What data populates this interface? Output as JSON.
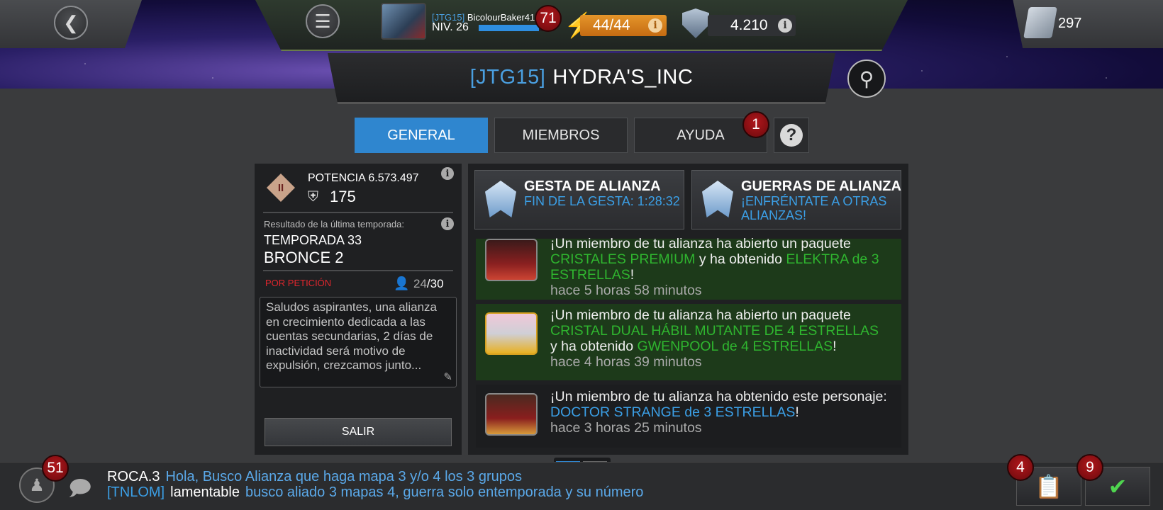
{
  "top_bar": {
    "player_tag": "[JTG15]",
    "player_name": "BicolourBaker41",
    "player_level": "NIV. 26",
    "xp_progress": 0.85,
    "level_badge": "71",
    "energy": "44/44",
    "units": "4.210",
    "crystals": "297"
  },
  "alliance": {
    "tag": "[JTG15]",
    "name": "HYDRA'S_INC"
  },
  "tabs": {
    "general": "GENERAL",
    "members": "MIEMBROS",
    "help": "AYUDA",
    "help_badge": "1"
  },
  "overview": {
    "potency_label": "POTENCIA 6.573.497",
    "rank": "175",
    "season_caption": "Resultado de la última temporada:",
    "season_name": "TEMPORADA 33",
    "season_tier": "BRONCE 2",
    "request_label": "POR PETICIÓN",
    "member_current": "24",
    "member_max": "/30",
    "description": "Saludos aspirantes, una alianza en crecimiento dedicada a las cuentas secundarias, 2 días de inactividad será motivo de expulsión, crezcamos junto...",
    "leave_label": "SALIR"
  },
  "events": [
    {
      "title": "GESTA DE ALIANZA",
      "subtitle": "FIN DE LA GESTA: 1:28:32"
    },
    {
      "title": "GUERRAS DE ALIANZA",
      "subtitle": "¡ENFRÉNTATE A OTRAS ALIANZAS!"
    }
  ],
  "feed": [
    {
      "prefix": "¡Un miembro de tu alianza ha abierto un paquete",
      "item": "CRISTALES PREMIUM",
      "middle": "y ha obtenido",
      "reward": "ELEKTRA de 3 ESTRELLAS",
      "suffix": "!",
      "time": "hace 5 horas 58 minutos"
    },
    {
      "prefix": "¡Un miembro de tu alianza ha abierto un paquete",
      "item": "CRISTAL DUAL HÁBIL MUTANTE DE 4 ESTRELLAS",
      "middle": "y ha obtenido",
      "reward": "GWENPOOL de 4 ESTRELLAS",
      "suffix": "!",
      "time": "hace 4 horas 39 minutos"
    },
    {
      "prefix": "¡Un miembro de tu alianza ha obtenido este personaje:",
      "reward": "DOCTOR STRANGE de 3 ESTRELLAS",
      "suffix": "!",
      "time": "hace 3 horas 25 minutos"
    }
  ],
  "chat": {
    "badge": "51",
    "messages": [
      {
        "tag": "",
        "author": "ROCA.3",
        "text": "Hola, Busco Alianza que haga mapa 3 y/o 4 los 3 grupos"
      },
      {
        "tag": "[TNLOM]",
        "author": "lamentable",
        "text": "busco aliado 3 mapas 4, guerra solo entemporada y su número"
      }
    ]
  },
  "corner_buttons": {
    "tasks_badge": "4",
    "complete_badge": "9"
  },
  "colors": {
    "accent_blue": "#2f86cf",
    "link_blue": "#3b9fe6",
    "reward_green": "#2fb52f",
    "badge_red": "#b0161b",
    "request_red": "#e0262d",
    "energy_orange": "#e5952a"
  }
}
